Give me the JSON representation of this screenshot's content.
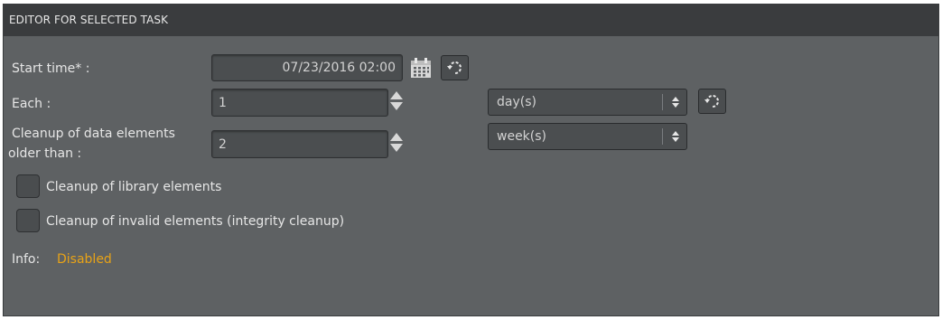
{
  "panel": {
    "title": "EDITOR FOR SELECTED TASK"
  },
  "start_time": {
    "label": "Start time* :",
    "value": "07/23/2016 02:00",
    "calendar_icon": "calendar-icon",
    "reset_icon": "refresh-icon"
  },
  "each": {
    "label": "Each :",
    "value": "1",
    "unit": "day(s)",
    "reset_icon": "refresh-icon"
  },
  "cleanup_data": {
    "label_line1": "Cleanup of data elements",
    "label_line2": "older than :",
    "value": "2",
    "unit": "week(s)"
  },
  "checkboxes": [
    {
      "label": "Cleanup of library elements",
      "checked": false
    },
    {
      "label": "Cleanup of invalid elements (integrity cleanup)",
      "checked": false
    }
  ],
  "info": {
    "label": "Info:",
    "value": "Disabled",
    "value_color": "#e8a317"
  }
}
